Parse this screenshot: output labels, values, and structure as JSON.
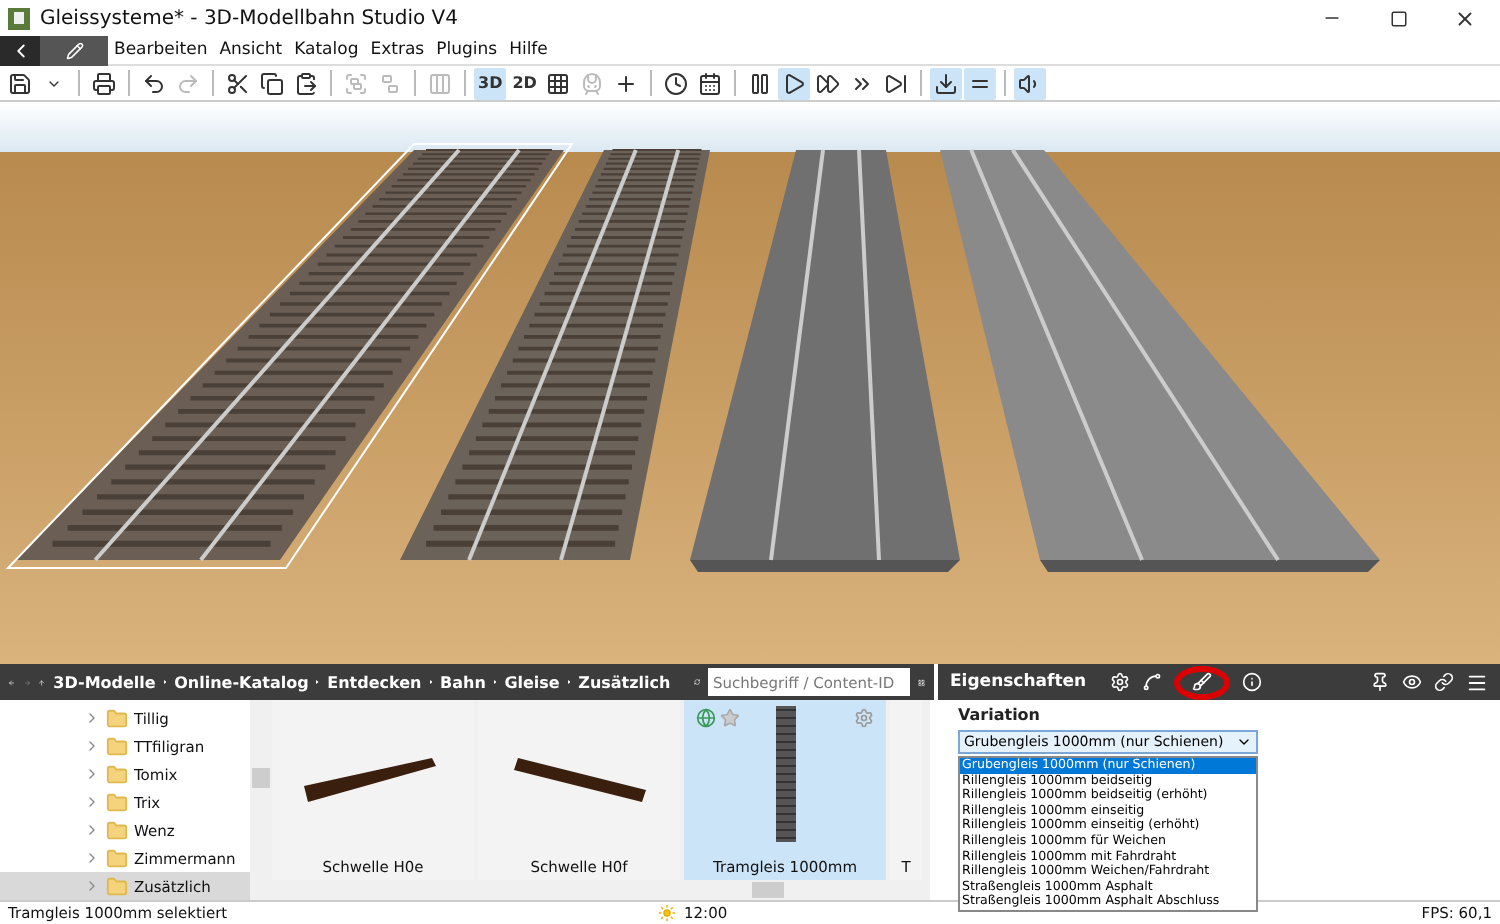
{
  "window": {
    "title": "Gleissysteme* - 3D-Modellbahn Studio V4"
  },
  "menu": [
    "Bearbeiten",
    "Ansicht",
    "Katalog",
    "Extras",
    "Plugins",
    "Hilfe"
  ],
  "toolbar": [
    {
      "on": false,
      "disabled": false
    },
    {
      "on": false,
      "disabled": false
    },
    {
      "on": false,
      "disabled": false
    },
    {
      "on": false,
      "disabled": false
    },
    {
      "on": false,
      "disabled": true
    },
    {
      "on": false,
      "disabled": false
    },
    {
      "on": false,
      "disabled": false
    },
    {
      "on": false,
      "disabled": false
    },
    {
      "on": false,
      "disabled": true
    },
    {
      "on": false,
      "disabled": true
    },
    {
      "on": false,
      "disabled": true
    },
    {
      "label": "3D",
      "on": true,
      "disabled": false
    },
    {
      "label": "2D",
      "on": false,
      "disabled": false
    },
    {
      "on": false,
      "disabled": false
    },
    {
      "on": false,
      "disabled": true
    },
    {
      "on": false,
      "disabled": false
    },
    {
      "on": false,
      "disabled": false
    },
    {
      "on": false,
      "disabled": false
    },
    {
      "on": false,
      "disabled": false
    },
    {
      "on": true,
      "disabled": false
    },
    {
      "on": false,
      "disabled": false
    },
    {
      "on": false,
      "disabled": false
    },
    {
      "on": false,
      "disabled": false
    },
    {
      "on": true,
      "disabled": false
    },
    {
      "on": true,
      "disabled": false
    },
    {
      "on": true,
      "disabled": false
    }
  ],
  "breadcrumb": [
    "3D-Modelle",
    "Online-Katalog",
    "Entdecken",
    "Bahn",
    "Gleise",
    "Zusätzlich"
  ],
  "search": {
    "placeholder": "Suchbegriff / Content-ID"
  },
  "tree": [
    {
      "label": "Tillig",
      "selected": false
    },
    {
      "label": "TTfiligran",
      "selected": false
    },
    {
      "label": "Tomix",
      "selected": false
    },
    {
      "label": "Trix",
      "selected": false
    },
    {
      "label": "Wenz",
      "selected": false
    },
    {
      "label": "Zimmermann",
      "selected": false
    },
    {
      "label": "Zusätzlich",
      "selected": true
    }
  ],
  "tiles": [
    {
      "label": "Schwelle H0e",
      "kind": "sleeper-left",
      "selected": false
    },
    {
      "label": "Schwelle H0f",
      "kind": "sleeper-right",
      "selected": false
    },
    {
      "label": "Tramgleis 1000mm",
      "kind": "track",
      "selected": true
    },
    {
      "label": "T",
      "kind": "cut",
      "selected": false
    }
  ],
  "properties": {
    "title": "Eigenschaften",
    "field_label": "Variation",
    "value": "Grubengleis 1000mm (nur Schienen)",
    "options": [
      {
        "label": "Grubengleis 1000mm (nur Schienen)",
        "selected": true
      },
      {
        "label": "Rillengleis 1000mm beidseitig",
        "selected": false
      },
      {
        "label": "Rillengleis 1000mm beidseitig (erhöht)",
        "selected": false
      },
      {
        "label": "Rillengleis 1000mm einseitig",
        "selected": false
      },
      {
        "label": "Rillengleis 1000mm einseitig (erhöht)",
        "selected": false
      },
      {
        "label": "Rillengleis 1000mm für Weichen",
        "selected": false
      },
      {
        "label": "Rillengleis 1000mm mit Fahrdraht",
        "selected": false
      },
      {
        "label": "Rillengleis 1000mm Weichen/Fahrdraht",
        "selected": false
      },
      {
        "label": "Straßengleis 1000mm Asphalt",
        "selected": false
      },
      {
        "label": "Straßengleis 1000mm Asphalt Abschluss",
        "selected": false
      }
    ]
  },
  "status_bar": {
    "message": "Tramgleis 1000mm selektiert",
    "time": "12:00",
    "fps": "FPS: 60,1"
  }
}
